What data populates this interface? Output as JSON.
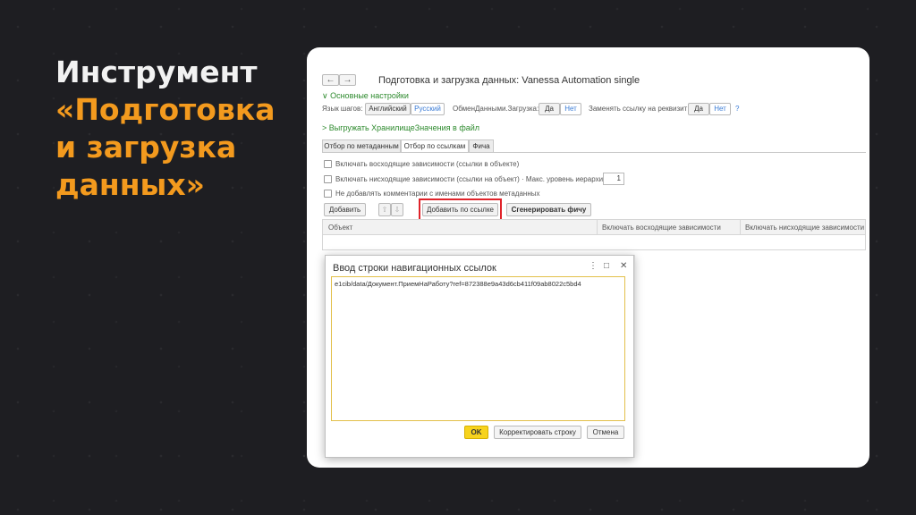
{
  "slide": {
    "title_line1": "Инструмент",
    "title_line2": "«Подготовка",
    "title_line3": "и загрузка",
    "title_line4": "данных»",
    "accent_color": "#f39a1e"
  },
  "window": {
    "back_icon": "←",
    "forward_icon": "→",
    "title": "Подготовка и загрузка данных: Vanessa Automation single"
  },
  "settings": {
    "section_label": "∨ Основные настройки",
    "step_lang_label": "Язык шагов:",
    "lang_english": "Английский",
    "lang_russian": "Русский",
    "exchange_label": "ОбменДанными.Загрузка:",
    "yes": "Да",
    "no": "Нет",
    "replace_label": "Заменять ссылку на реквизит:",
    "help": "?"
  },
  "export_section": "> Выгружать ХранилищеЗначения в файл",
  "tabs": [
    {
      "label": "Отбор по метаданным"
    },
    {
      "label": "Отбор по ссылкам"
    },
    {
      "label": "Фича"
    }
  ],
  "options": {
    "include_up": "Включать восходящие зависимости (ссылки в объекте)",
    "include_down": "Включать нисходящие зависимости (ссылки на объект) · Макс. уровень иерархии:",
    "max_level": "1",
    "no_comments": "Не добавлять комментарии с именами объектов метаданных"
  },
  "toolbar": {
    "add": "Добавить",
    "up_icon": "⇧",
    "down_icon": "⇩",
    "add_by_link": "Добавить по ссылке",
    "generate": "Сгенерировать фичу"
  },
  "grid": {
    "col_object": "Объект",
    "col_up": "Включать восходящие зависимости",
    "col_down": "Включать нисходящие зависимости"
  },
  "dialog": {
    "title": "Ввод строки навигационных ссылок",
    "more_icon": "⋮",
    "max_icon": "□",
    "close_icon": "✕",
    "text": "e1cib/data/Документ.ПриемНаРаботу?ref=872388e9a43d6cb411f09ab8022c5bd4",
    "ok": "OK",
    "fix_line": "Корректировать строку",
    "cancel": "Отмена"
  }
}
